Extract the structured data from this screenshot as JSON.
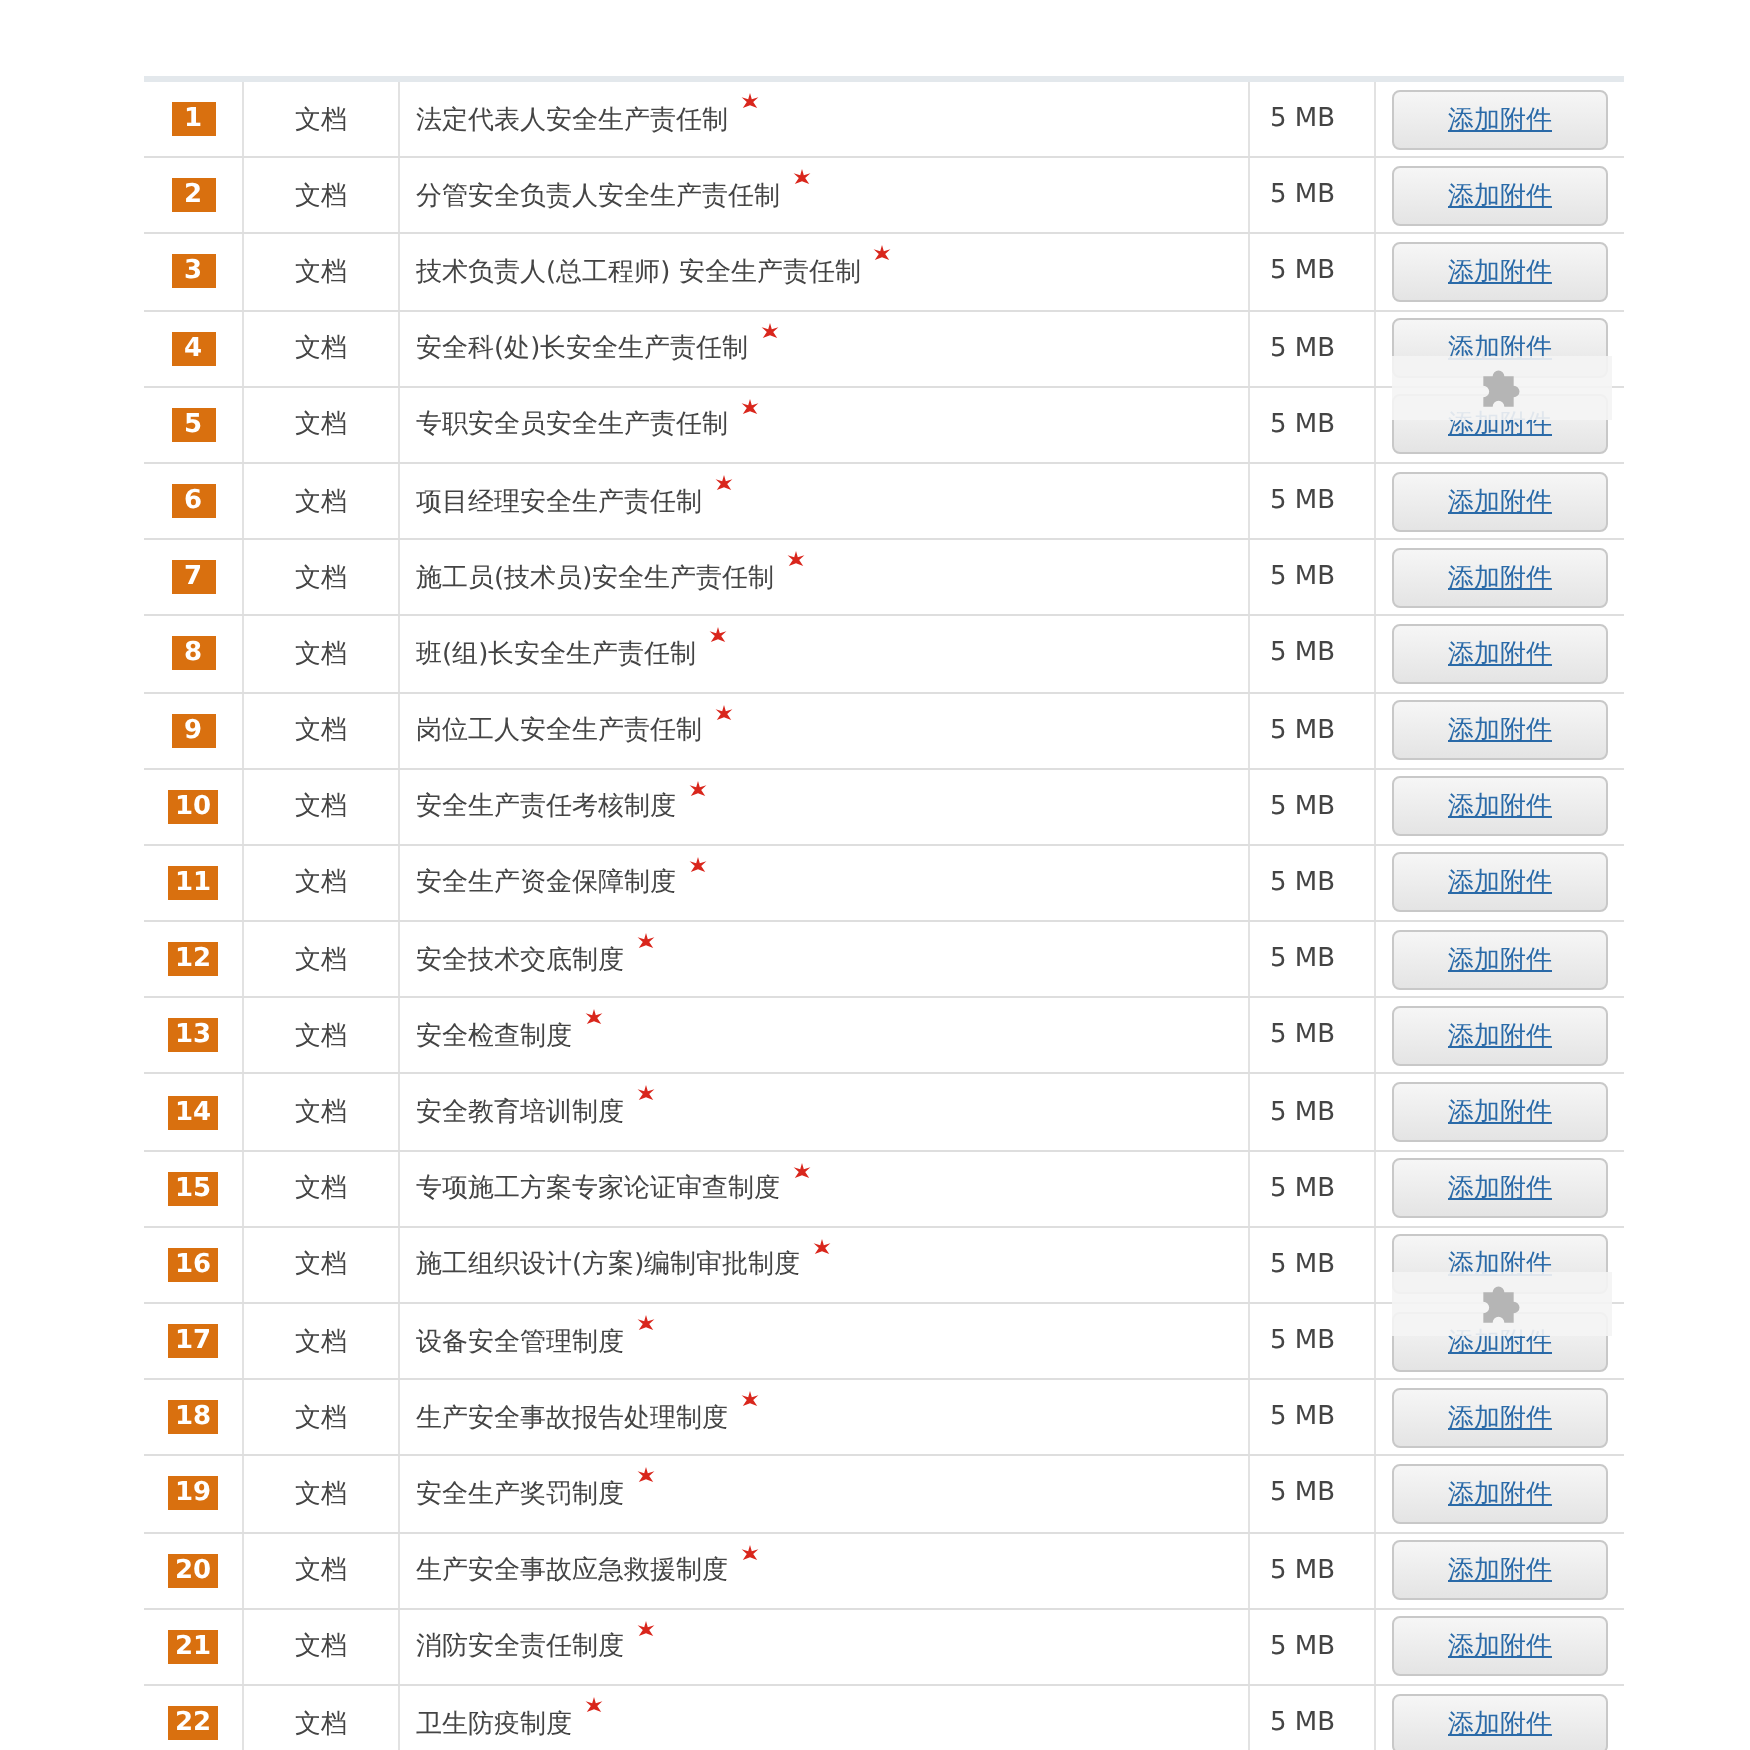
{
  "rows": [
    {
      "number": "1",
      "type": "文档",
      "name": "法定代表人安全生产责任制",
      "required": true,
      "size": "5 MB",
      "button": "添加附件",
      "plugin_overlay": false
    },
    {
      "number": "2",
      "type": "文档",
      "name": "分管安全负责人安全生产责任制",
      "required": true,
      "size": "5 MB",
      "button": "添加附件",
      "plugin_overlay": false
    },
    {
      "number": "3",
      "type": "文档",
      "name": "技术负责人(总工程师) 安全生产责任制",
      "required": true,
      "size": "5 MB",
      "button": "添加附件",
      "plugin_overlay": false
    },
    {
      "number": "4",
      "type": "文档",
      "name": "安全科(处)长安全生产责任制",
      "required": true,
      "size": "5 MB",
      "button": "添加附件",
      "plugin_overlay": true
    },
    {
      "number": "5",
      "type": "文档",
      "name": "专职安全员安全生产责任制",
      "required": true,
      "size": "5 MB",
      "button": "添加附件",
      "plugin_overlay": false
    },
    {
      "number": "6",
      "type": "文档",
      "name": "项目经理安全生产责任制",
      "required": true,
      "size": "5 MB",
      "button": "添加附件",
      "plugin_overlay": false
    },
    {
      "number": "7",
      "type": "文档",
      "name": "施工员(技术员)安全生产责任制",
      "required": true,
      "size": "5 MB",
      "button": "添加附件",
      "plugin_overlay": false
    },
    {
      "number": "8",
      "type": "文档",
      "name": "班(组)长安全生产责任制",
      "required": true,
      "size": "5 MB",
      "button": "添加附件",
      "plugin_overlay": false
    },
    {
      "number": "9",
      "type": "文档",
      "name": "岗位工人安全生产责任制",
      "required": true,
      "size": "5 MB",
      "button": "添加附件",
      "plugin_overlay": false
    },
    {
      "number": "10",
      "type": "文档",
      "name": "安全生产责任考核制度",
      "required": true,
      "size": "5 MB",
      "button": "添加附件",
      "plugin_overlay": false
    },
    {
      "number": "11",
      "type": "文档",
      "name": "安全生产资金保障制度",
      "required": true,
      "size": "5 MB",
      "button": "添加附件",
      "plugin_overlay": false
    },
    {
      "number": "12",
      "type": "文档",
      "name": "安全技术交底制度",
      "required": true,
      "size": "5 MB",
      "button": "添加附件",
      "plugin_overlay": false
    },
    {
      "number": "13",
      "type": "文档",
      "name": "安全检查制度",
      "required": true,
      "size": "5 MB",
      "button": "添加附件",
      "plugin_overlay": false
    },
    {
      "number": "14",
      "type": "文档",
      "name": "安全教育培训制度",
      "required": true,
      "size": "5 MB",
      "button": "添加附件",
      "plugin_overlay": false
    },
    {
      "number": "15",
      "type": "文档",
      "name": "专项施工方案专家论证审查制度",
      "required": true,
      "size": "5 MB",
      "button": "添加附件",
      "plugin_overlay": false
    },
    {
      "number": "16",
      "type": "文档",
      "name": "施工组织设计(方案)编制审批制度",
      "required": true,
      "size": "5 MB",
      "button": "添加附件",
      "plugin_overlay": true
    },
    {
      "number": "17",
      "type": "文档",
      "name": "设备安全管理制度",
      "required": true,
      "size": "5 MB",
      "button": "添加附件",
      "plugin_overlay": false
    },
    {
      "number": "18",
      "type": "文档",
      "name": "生产安全事故报告处理制度",
      "required": true,
      "size": "5 MB",
      "button": "添加附件",
      "plugin_overlay": false
    },
    {
      "number": "19",
      "type": "文档",
      "name": "安全生产奖罚制度",
      "required": true,
      "size": "5 MB",
      "button": "添加附件",
      "plugin_overlay": false
    },
    {
      "number": "20",
      "type": "文档",
      "name": "生产安全事故应急救援制度",
      "required": true,
      "size": "5 MB",
      "button": "添加附件",
      "plugin_overlay": false
    },
    {
      "number": "21",
      "type": "文档",
      "name": "消防安全责任制度",
      "required": true,
      "size": "5 MB",
      "button": "添加附件",
      "plugin_overlay": false
    },
    {
      "number": "22",
      "type": "文档",
      "name": "卫生防疫制度",
      "required": true,
      "size": "5 MB",
      "button": "添加附件",
      "plugin_overlay": false
    }
  ]
}
